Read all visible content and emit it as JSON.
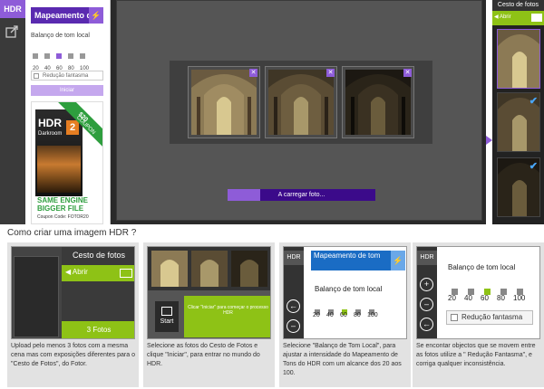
{
  "toolbar": {
    "hdr_label": "HDR"
  },
  "left_panel": {
    "title": "Mapeamento d...",
    "balance_label": "Balanço de tom local",
    "steps": [
      "20",
      "40",
      "60",
      "80",
      "100"
    ],
    "selected_step": "60",
    "ghost_label": "Redução fantasma",
    "start_label": "Iniciar"
  },
  "ad": {
    "ribbon": "$20",
    "ribbon_sub": "COUPON",
    "product_line1": "HDR",
    "product_line2": "Darkroom",
    "product_version": "2",
    "tagline_line1": "SAME ENGINE",
    "tagline_line2": "BIGGER FILE",
    "coupon_code": "Coupon Code: FOTOR20"
  },
  "main": {
    "progress_label": "A carregar foto...",
    "progress_fraction": 0.22,
    "thumb_close": "✕"
  },
  "right_panel": {
    "title": "Cesto de fotos",
    "open_label": "◀ Abrir"
  },
  "help": {
    "title": "Como criar uma imagem HDR ?",
    "cards": [
      {
        "title": "Cesto de fotos",
        "open": "◀ Abrir",
        "footer": "3 Fotos",
        "text": "Upload pelo menos 3 fotos com a mesma cena mas com exposições diferentes para o \"Cesto de Fotos\", do Fotor."
      },
      {
        "start": "Start",
        "button": "Clicar \"Iniciar\" para começar o processo HDR",
        "text": "Selecione as fotos do Cesto de Fotos e clique \"Iniciar\", para entrar no mundo do HDR."
      },
      {
        "title": "Mapeamento de tom",
        "label": "Balanço de tom local",
        "steps": [
          "20",
          "40",
          "60",
          "80",
          "100"
        ],
        "text": "Selecione \"Balanço de Tom Local\", para ajustar a intensidade do Mapeamento de Tons do HDR com um alcance dos 20 aos 100."
      },
      {
        "label": "Balanço de tom local",
        "steps": [
          "20",
          "40",
          "60",
          "80",
          "100"
        ],
        "ghost": "Redução fantasma",
        "text": "Se encontar objectos que se movem entre as fotos utilize a \" Redução Fantasma\", e corriga qualquer inconsistência."
      }
    ]
  }
}
